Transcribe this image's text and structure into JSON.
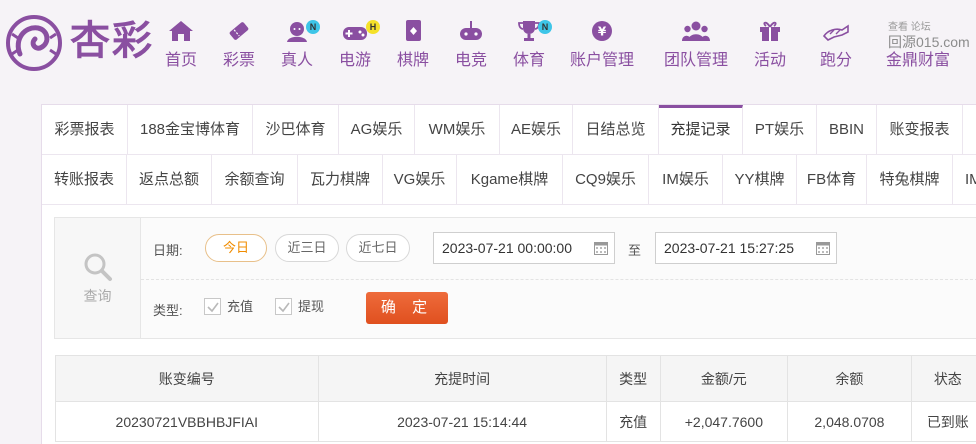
{
  "brand": {
    "name": "杏彩",
    "accent": "#8a4fa1"
  },
  "nav": [
    {
      "label": "首页",
      "icon": "home-icon"
    },
    {
      "label": "彩票",
      "icon": "lottery-ticket-icon"
    },
    {
      "label": "真人",
      "icon": "live-dealer-icon",
      "badge": "N",
      "badge_color": "#3ec5e8"
    },
    {
      "label": "电游",
      "icon": "gamepad-icon",
      "badge": "H",
      "badge_color": "#f5e12a"
    },
    {
      "label": "棋牌",
      "icon": "cards-icon"
    },
    {
      "label": "电竞",
      "icon": "esports-controller-icon"
    },
    {
      "label": "体育",
      "icon": "trophy-icon",
      "badge": "N",
      "badge_color": "#3ec5e8"
    },
    {
      "label": "账户管理",
      "icon": "yen-coin-icon"
    },
    {
      "label": "团队管理",
      "icon": "team-icon"
    },
    {
      "label": "活动",
      "icon": "gift-icon"
    },
    {
      "label": "跑分",
      "icon": "running-icon"
    },
    {
      "label": "金鼎财富",
      "icon": ""
    }
  ],
  "watermark": {
    "small": "查看 论坛",
    "big": "回源015.com"
  },
  "tabs_row1": [
    "彩票报表",
    "188金宝博体育",
    "沙巴体育",
    "AG娱乐",
    "WM娱乐",
    "AE娱乐",
    "日结总览",
    "充提记录",
    "PT娱乐",
    "BBIN",
    "账变报表"
  ],
  "tabs_row2": [
    "转账报表",
    "返点总额",
    "余额查询",
    "瓦力棋牌",
    "VG娱乐",
    "Kgame棋牌",
    "CQ9娱乐",
    "IM娱乐",
    "YY棋牌",
    "FB体育",
    "特兔棋牌",
    "IM"
  ],
  "active_tab": "充提记录",
  "filter": {
    "query_label": "查询",
    "date_label": "日期:",
    "quick_ranges": [
      "今日",
      "近三日",
      "近七日"
    ],
    "active_range": "今日",
    "start": "2023-07-21 00:00:00",
    "to_label": "至",
    "end": "2023-07-21 15:27:25",
    "type_label": "类型:",
    "types": [
      {
        "label": "充值",
        "checked": true
      },
      {
        "label": "提现",
        "checked": true
      }
    ],
    "confirm": "确 定"
  },
  "table": {
    "headers": [
      "账变编号",
      "充提时间",
      "类型",
      "金额/元",
      "余额",
      "状态"
    ],
    "rows": [
      {
        "id": "20230721VBBHBJFIAI",
        "time": "2023-07-21 15:14:44",
        "type": "充值",
        "amount": "+2,047.7600",
        "balance": "2,048.0708",
        "status": "已到账"
      }
    ]
  }
}
